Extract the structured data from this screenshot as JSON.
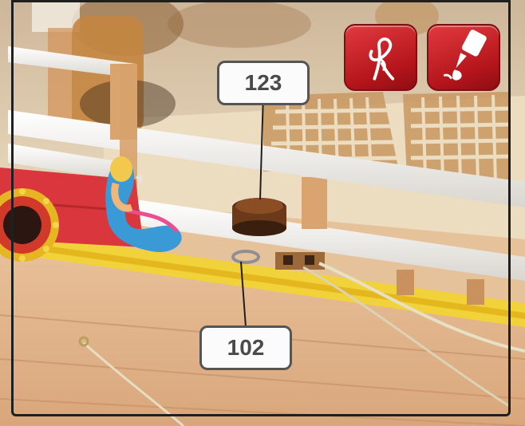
{
  "callouts": {
    "top_label": "123",
    "bottom_label": "102"
  },
  "badges": [
    {
      "name": "rope-knot-icon",
      "accent": "#c8191f"
    },
    {
      "name": "glue-bottle-icon",
      "accent": "#c8191f"
    }
  ]
}
